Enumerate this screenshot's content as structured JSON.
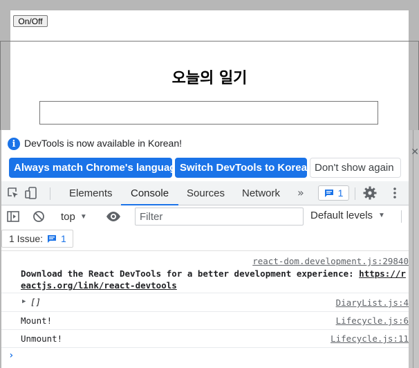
{
  "app": {
    "toggle_label": "On/Off",
    "title": "오늘의 일기",
    "input_value": ""
  },
  "devtools": {
    "infobar": {
      "message": "DevTools is now available in Korean!",
      "btn_match": "Always match Chrome's language",
      "btn_switch": "Switch DevTools to Korean",
      "btn_dont": "Don't show again"
    },
    "tabs": [
      {
        "label": "Elements"
      },
      {
        "label": "Console"
      },
      {
        "label": "Sources"
      },
      {
        "label": "Network"
      }
    ],
    "more_tabs": "»",
    "issues_count": "1",
    "console_toolbar": {
      "context": "top",
      "filter_placeholder": "Filter",
      "levels": "Default levels"
    },
    "issues_bar": {
      "label": "1 Issue:",
      "count": "1"
    },
    "messages": [
      {
        "text": "Download the React DevTools for a better development experience: ",
        "url": "https://reactjs.org/link/react-devtools",
        "source": "react-dom.development.js:29840"
      },
      {
        "text": "[]",
        "source": "DiaryList.js:4"
      },
      {
        "text": "Mount!",
        "source": "Lifecycle.js:6"
      },
      {
        "text": "Unmount!",
        "source": "Lifecycle.js:11"
      }
    ],
    "prompt": "›"
  },
  "colors": {
    "accent": "#1a73e8",
    "toolbar_bg": "#f1f3f4"
  }
}
